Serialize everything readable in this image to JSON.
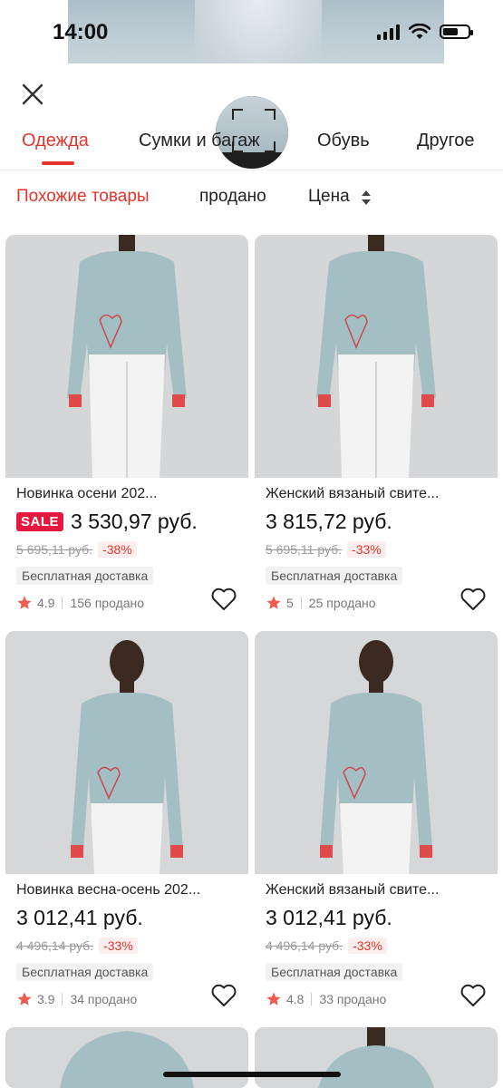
{
  "status": {
    "time": "14:00"
  },
  "tabs": [
    {
      "label": "Одежда"
    },
    {
      "label": "Сумки и багаж"
    },
    {
      "label": "Обувь"
    },
    {
      "label": "Другое"
    }
  ],
  "sort": {
    "similar": "Похожие товары",
    "sold": "продано",
    "price": "Цена"
  },
  "products": [
    {
      "title": "Новинка осени 202...",
      "sale_badge": "SALE",
      "price": "3 530,97 руб.",
      "old_price": "5 695,11 руб.",
      "discount": "-38%",
      "shipping": "Бесплатная доставка",
      "rating": "4.9",
      "sold": "156 продано"
    },
    {
      "title": "Женский вязаный свите...",
      "price": "3 815,72 руб.",
      "old_price": "5 695,11 руб.",
      "discount": "-33%",
      "shipping": "Бесплатная доставка",
      "rating": "5",
      "sold": "25 продано"
    },
    {
      "title": "Новинка весна-осень 202...",
      "price": "3 012,41 руб.",
      "old_price": "4 496,14 руб.",
      "discount": "-33%",
      "shipping": "Бесплатная доставка",
      "rating": "3.9",
      "sold": "34 продано"
    },
    {
      "title": "Женский вязаный свите...",
      "price": "3 012,41 руб.",
      "old_price": "4 496,14 руб.",
      "discount": "-33%",
      "shipping": "Бесплатная доставка",
      "rating": "4.8",
      "sold": "33 продано"
    }
  ],
  "icons": {
    "close": "close-icon",
    "heart": "heart-icon",
    "star": "star-icon",
    "sort_arrows": "sort-arrows-icon"
  },
  "colors": {
    "accent": "#e5342c",
    "sale": "#e5173f",
    "star": "#f05a50"
  }
}
